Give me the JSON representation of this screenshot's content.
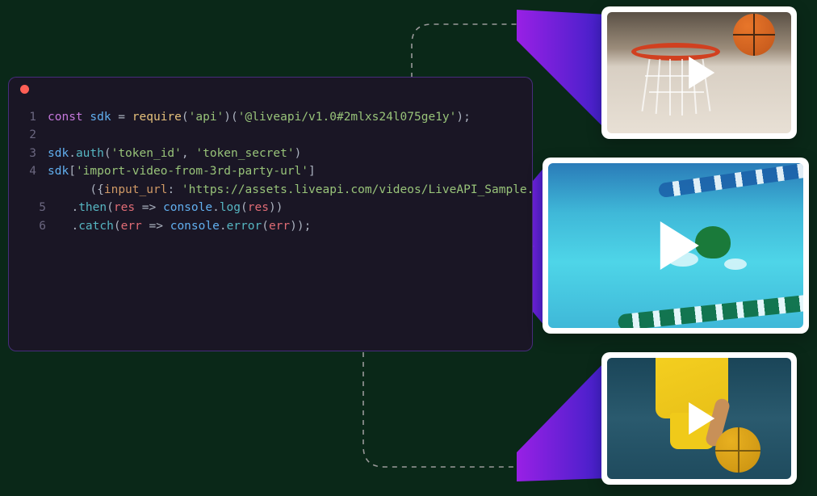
{
  "code": {
    "line_numbers": [
      "1",
      "2",
      "3",
      "4",
      "5",
      "6"
    ],
    "l1_kw": "const",
    "l1_var": " sdk",
    "l1_p1": " = ",
    "l1_func": "require",
    "l1_p2": "(",
    "l1_str1": "'api'",
    "l1_p3": ")(",
    "l1_str2": "'@liveapi/v1.0#2mlxs24l075ge1y'",
    "l1_p4": ");",
    "l3_var": "sdk",
    "l3_p1": ".",
    "l3_m": "auth",
    "l3_p2": "(",
    "l3_s1": "'token_id'",
    "l3_p3": ", ",
    "l3_s2": "'token_secret'",
    "l3_p4": ")",
    "l4_var": "sdk",
    "l4_p1": "[",
    "l4_s1": "'import-video-from-3rd-party-url'",
    "l4_p2": "]",
    "l4b_indent": "      ",
    "l4b_p1": "({",
    "l4b_attr": "input_url",
    "l4b_p2": ": ",
    "l4b_s1": "'https://assets.liveapi.com/videos/LiveAPI_Sample.mp",
    "l5_indent": "  ",
    "l5_p1": ".",
    "l5_m": "then",
    "l5_p2": "(",
    "l5_param": "res",
    "l5_p3": " => ",
    "l5_obj": "console",
    "l5_p4": ".",
    "l5_m2": "log",
    "l5_p5": "(",
    "l5_param2": "res",
    "l5_p6": "))",
    "l6_indent": "  ",
    "l6_p1": ".",
    "l6_m": "catch",
    "l6_p2": "(",
    "l6_param": "err",
    "l6_p3": " => ",
    "l6_obj": "console",
    "l6_p4": ".",
    "l6_m2": "error",
    "l6_p5": "(",
    "l6_param2": "err",
    "l6_p6": "));"
  },
  "thumbnails": [
    {
      "id": "basketball-hoop",
      "size": "small"
    },
    {
      "id": "swimmer",
      "size": "large"
    },
    {
      "id": "basketball-player",
      "size": "small"
    }
  ]
}
